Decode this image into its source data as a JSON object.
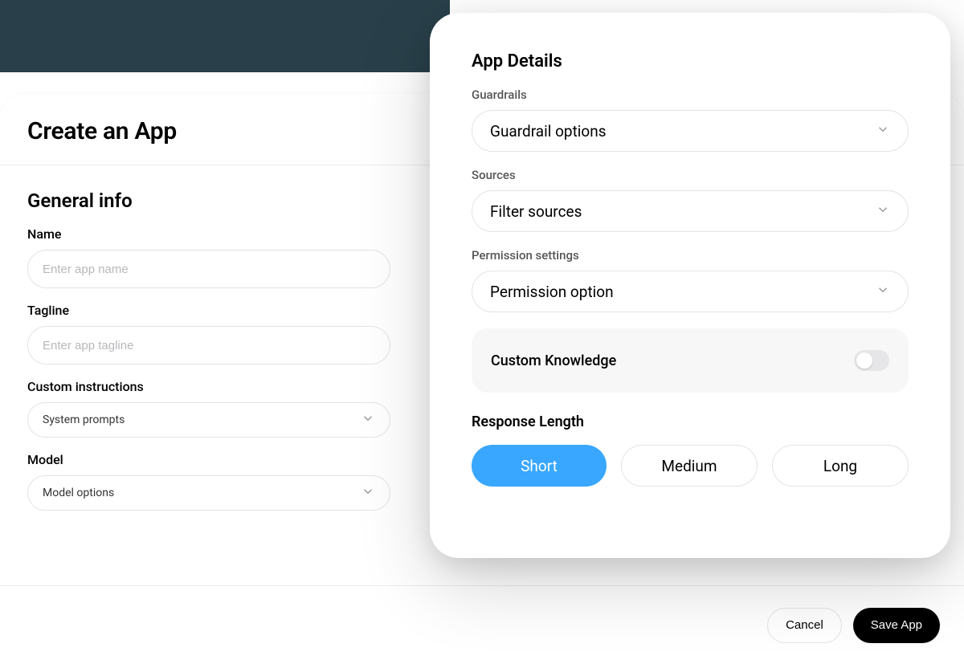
{
  "header": {
    "title": "Create an App"
  },
  "general": {
    "section_title": "General info",
    "name_label": "Name",
    "name_placeholder": "Enter app name",
    "tagline_label": "Tagline",
    "tagline_placeholder": "Enter app tagline",
    "custom_instructions_label": "Custom instructions",
    "custom_instructions_value": "System prompts",
    "model_label": "Model",
    "model_value": "Model options"
  },
  "details": {
    "title": "App Details",
    "guardrails_label": "Guardrails",
    "guardrails_value": "Guardrail options",
    "sources_label": "Sources",
    "sources_value": "Filter sources",
    "permission_label": "Permission settings",
    "permission_value": "Permission option",
    "custom_knowledge_label": "Custom Knowledge",
    "custom_knowledge_on": false,
    "response_length_title": "Response Length",
    "segments": {
      "short": "Short",
      "medium": "Medium",
      "long": "Long"
    },
    "selected_segment": "short"
  },
  "footer": {
    "cancel": "Cancel",
    "save": "Save App"
  },
  "colors": {
    "accent": "#39a7ff",
    "header_bg": "#29404a"
  }
}
